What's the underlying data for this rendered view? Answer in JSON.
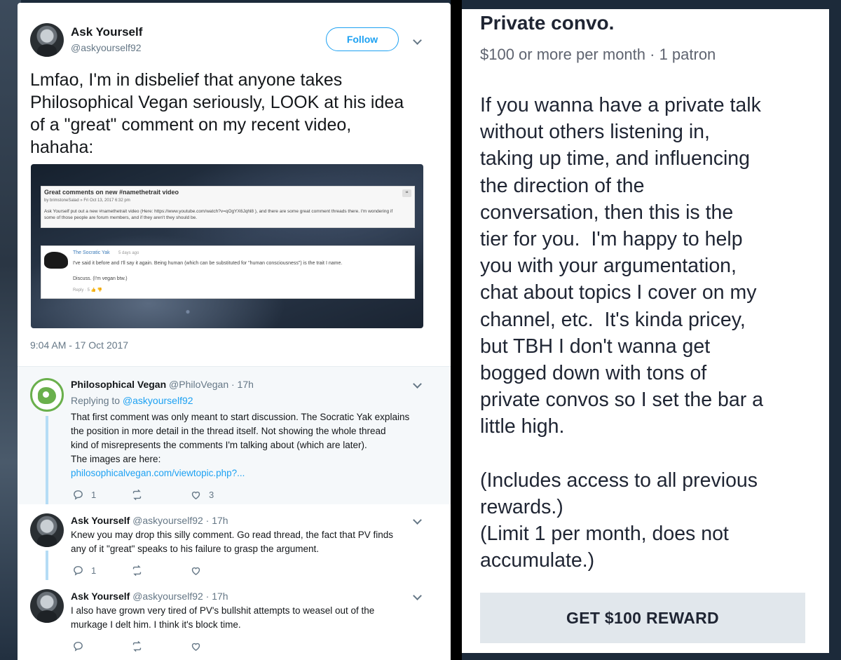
{
  "main_tweet": {
    "author_name": "Ask Yourself",
    "author_handle": "@askyourself92",
    "follow_label": "Follow",
    "text": "Lmfao, I'm in disbelief that anyone takes Philosophical Vegan seriously, LOOK at his idea of a \"great\" comment on my recent video, hahaha:",
    "timestamp": "9:04 AM - 17 Oct 2017",
    "media": {
      "post_title": "Great comments on new #namethetrait video",
      "post_meta": "by brimstoneSalad » Fri Oct 13, 2017 6:32 pm",
      "post_body": "Ask Yourself put out a new #namethetrait video (Here: https://www.youtube.com/watch?v=qOgYX6Jqhl8 ), and there are some great comment threads there. I'm wondering if some of those people are forum members, and if they aren't they should be.",
      "comment_author": "The Socratic Yak",
      "comment_time": "5 days ago",
      "comment_body": "I've said it before and I'll say it again. Being human (which can be substituted for \"human consciousness\") is the trait I name.",
      "comment_discuss": "Discuss. (I'm vegan btw.)",
      "comment_actions": "Reply · 5 👍 👎"
    }
  },
  "replies": [
    {
      "author_name": "Philosophical Vegan",
      "author_handle": "@PhiloVegan · 17h",
      "replying_prefix": "Replying to",
      "replying_to": "@askyourself92",
      "lines": [
        "That first comment was only meant to start discussion. The Socratic Yak explains",
        "the position in more detail in the thread itself.  Not showing the whole thread",
        "kind of misrepresents the comments I'm talking about (which are later).",
        "The images are here:"
      ],
      "link": "philosophicalvegan.com/viewtopic.php?...",
      "reply_count": "1",
      "retweet_count": "",
      "like_count": "3"
    },
    {
      "author_name": "Ask Yourself",
      "author_handle": "@askyourself92 · 17h",
      "lines": [
        "Knew you may drop this silly comment.  Go read thread, the fact that PV finds",
        "any of it \"great\" speaks to his failure to grasp the argument."
      ],
      "reply_count": "1",
      "retweet_count": "",
      "like_count": ""
    },
    {
      "author_name": "Ask Yourself",
      "author_handle": "@askyourself92 · 17h",
      "lines": [
        "I also have grown very tired of PV's bullshit attempts to weasel out of the",
        "murkage I delt him.  I think it's block time."
      ],
      "reply_count": "",
      "retweet_count": "",
      "like_count": ""
    }
  ],
  "patreon_tier": {
    "title": "Private convo.",
    "meta": "$100 or more per month · 1 patron",
    "description": "If you wanna have a private talk\nwithout others listening in,\ntaking up time, and influencing\nthe direction of the\nconversation, then this is the\ntier for you.  I'm happy to help\nyou with your argumentation,\nchat about topics I cover on my\nchannel, etc.  It's kinda pricey,\nbut TBH I don't wanna get\nbogged down with tons of\nprivate convos so I set the bar a\nlittle high.\n\n(Includes access to all previous\nrewards.)\n(Limit 1 per month, does not\naccumulate.)",
    "button_label": "GET $100 REWARD"
  },
  "colors": {
    "twitter_blue": "#1da1f2",
    "muted_gray": "#657786",
    "thread_line": "#b5dcf5",
    "pv_green": "#6ab04c",
    "reward_button_bg": "#e1e7ec"
  }
}
